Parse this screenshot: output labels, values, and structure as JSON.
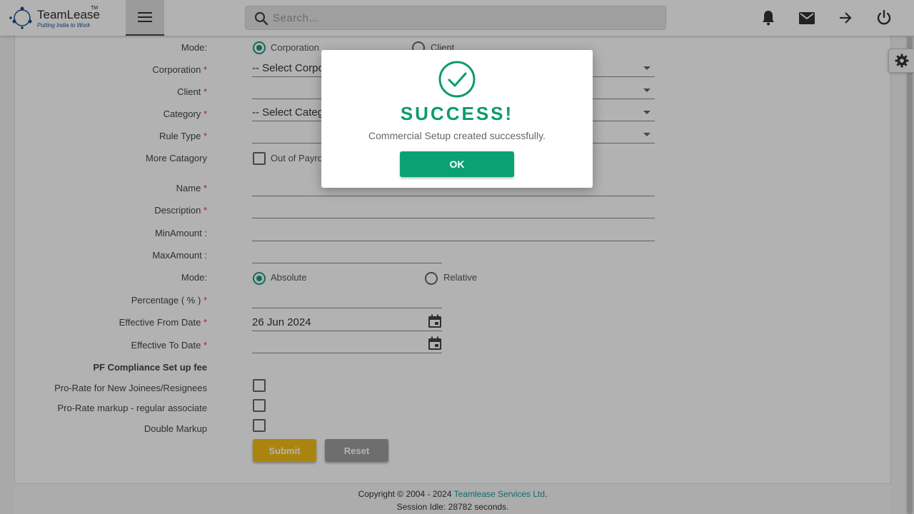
{
  "header": {
    "brand": "TeamLease",
    "tm": "TM",
    "tagline": "Putting India to Work",
    "search_placeholder": "Search...",
    "icons": [
      "menu-icon",
      "search-icon",
      "bell-icon",
      "mail-icon",
      "arrow-right-icon",
      "power-icon"
    ]
  },
  "form": {
    "mode_label": "Mode:",
    "mode_options": [
      "Corporation",
      "Client"
    ],
    "corporation_label": "Corporation",
    "corporation_value": "-- Select Corpo",
    "client_label": "Client",
    "category_label": "Category",
    "category_value": "-- Select Categ",
    "rule_type_label": "Rule Type",
    "more_category_label": "More Catagory",
    "more_category_option": "Out of Payro",
    "name_label": "Name",
    "description_label": "Description",
    "min_amount_label": "MinAmount :",
    "max_amount_label": "MaxAmount :",
    "mode2_label": "Mode:",
    "mode2_options": [
      "Absolute",
      "Relative"
    ],
    "percentage_label": "Percentage ( % )",
    "eff_from_label": "Effective From Date",
    "eff_from_value": "26 Jun 2024",
    "eff_to_label": "Effective To Date",
    "pf_label": "PF Compliance Set up fee",
    "prorate_new_label": "Pro-Rate for New Joinees/Resignees",
    "prorate_markup_label": "Pro-Rate markup - regular associate",
    "double_markup_label": "Double Markup",
    "required_mark": "*",
    "submit_label": "Submit",
    "reset_label": "Reset"
  },
  "footer": {
    "copyright": "Copyright © 2004 - 2024 ",
    "company": "Teamlease Services Ltd",
    "period": ".",
    "session": "Session Idle: 28782 seconds."
  },
  "modal": {
    "title": "SUCCESS!",
    "message": "Commercial Setup created successfully.",
    "ok_label": "OK"
  },
  "colors": {
    "accent": "#1a9a82",
    "success": "#0a9b6e",
    "submit": "#f4be16",
    "reset": "#9e9e9e",
    "required": "#e53935"
  }
}
